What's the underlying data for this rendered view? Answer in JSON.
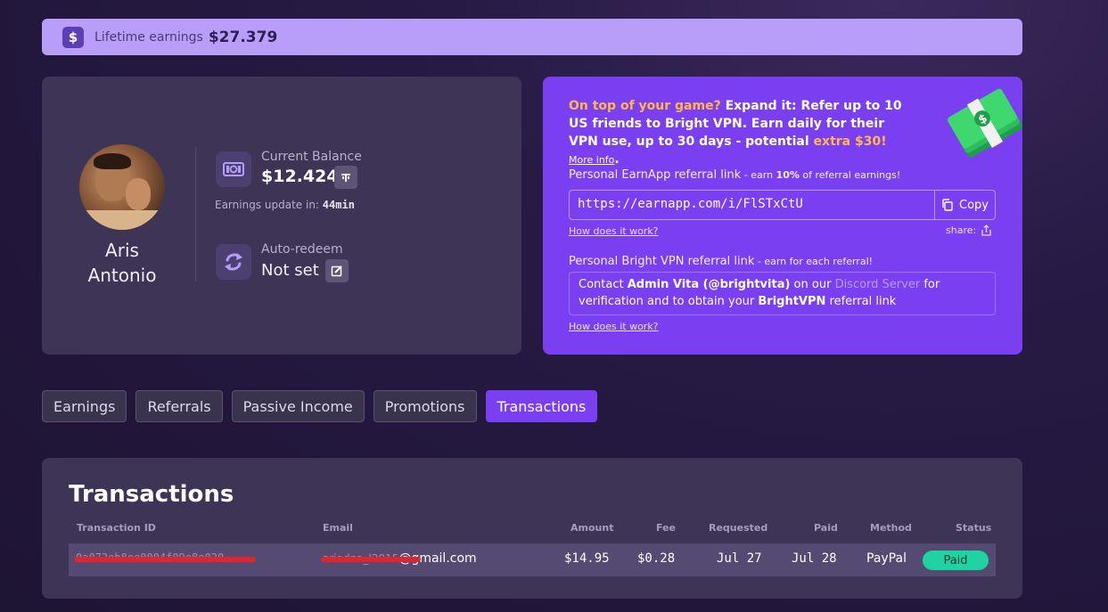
{
  "lifetime": {
    "label": "Lifetime earnings",
    "amount": "$27.379",
    "icon": "dollar-icon"
  },
  "profile": {
    "name_line1": "Aris",
    "name_line2": "Antonio",
    "balance_label": "Current Balance",
    "balance_value": "$12.424",
    "earnings_update_label": "Earnings update in:",
    "earnings_update_value": "44min",
    "auto_redeem_label": "Auto-redeem",
    "auto_redeem_value": "Not set"
  },
  "referral": {
    "headline_highlight": "On top of your game?",
    "headline_text": " Expand it: Refer up to 10 US friends to Bright VPN. Earn daily for their VPN use, up to 30 days - potential ",
    "headline_extra": "extra $30!",
    "more_info": "More info",
    "headline_end": ".",
    "earnapp_label": "Personal EarnApp referral link",
    "earnapp_sub_prefix": " - earn ",
    "earnapp_percent": "10%",
    "earnapp_sub_suffix": " of referral earnings!",
    "link": "https://earnapp.com/i/FlSTxCtU",
    "copy_label": "Copy",
    "how_it_works_1": "How does it work?",
    "share_label": "share:",
    "brightvpn_label": "Personal Bright VPN referral link",
    "brightvpn_sub": " - earn for each referral!",
    "contact_prefix": "Contact ",
    "contact_admin": "Admin Vita (@brightvita)",
    "contact_mid": " on our ",
    "contact_discord": "Discord Server",
    "contact_mid2": " for verification and to obtain your ",
    "contact_brightvpn": "BrightVPN",
    "contact_suffix": " referral link",
    "how_it_works_2": "How does it work?"
  },
  "tabs": [
    {
      "label": "Earnings",
      "active": false
    },
    {
      "label": "Referrals",
      "active": false
    },
    {
      "label": "Passive Income",
      "active": false
    },
    {
      "label": "Promotions",
      "active": false
    },
    {
      "label": "Transactions",
      "active": true
    }
  ],
  "transactions": {
    "title": "Transactions",
    "columns": [
      "Transaction ID",
      "Email",
      "Amount",
      "Fee",
      "Requested",
      "Paid",
      "Method",
      "Status"
    ],
    "rows": [
      {
        "id": "0a072eb8ee0004f09e8e020",
        "email_visible": "@gmail.com",
        "email_hidden": "ariadna_l2015",
        "amount": "$14.95",
        "fee": "$0.28",
        "requested": "Jul 27",
        "paid": "Jul 28",
        "method": "PayPal",
        "status": "Paid"
      }
    ]
  },
  "colors": {
    "accent": "#7b3ff2",
    "lifetime_bar": "#b89ef9",
    "status_paid": "#1fd3a3",
    "highlight": "#ffb74a"
  }
}
